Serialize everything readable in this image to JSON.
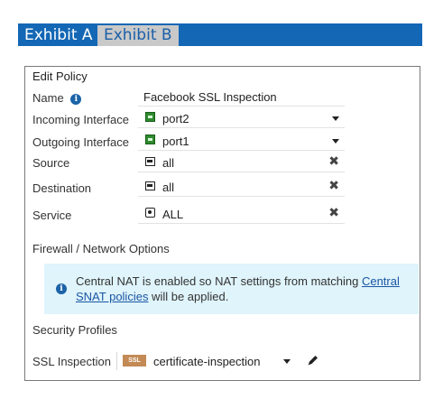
{
  "tabs": [
    {
      "label": "Exhibit A",
      "active": true
    },
    {
      "label": "Exhibit B",
      "active": false
    }
  ],
  "panel": {
    "title": "Edit Policy",
    "name": {
      "label": "Name",
      "value": "Facebook SSL Inspection",
      "icon": "info-icon"
    },
    "incoming": {
      "label": "Incoming Interface",
      "value": "port2",
      "icon": "port-icon"
    },
    "outgoing": {
      "label": "Outgoing Interface",
      "value": "port1",
      "icon": "port-icon"
    },
    "source": {
      "label": "Source",
      "value": "all",
      "icon": "address-object-icon"
    },
    "destination": {
      "label": "Destination",
      "value": "all",
      "icon": "address-object-icon"
    },
    "service": {
      "label": "Service",
      "value": "ALL",
      "icon": "service-icon"
    },
    "firewall_section": "Firewall / Network Options",
    "notice": {
      "text_before": "Central NAT is enabled so NAT settings from matching ",
      "link_text": "Central SNAT policies",
      "text_after": " will be applied."
    },
    "security_section": "Security Profiles",
    "ssl": {
      "label": "SSL Inspection",
      "badge": "SSL",
      "value": "certificate-inspection"
    }
  },
  "colors": {
    "tab_bar": "#1367b5",
    "tab_inactive": "#c9c9c9",
    "notice_bg": "#dff4fb",
    "link": "#1a55a3",
    "ssl_badge": "#c38a55",
    "port_icon": "#2e8b2e"
  }
}
